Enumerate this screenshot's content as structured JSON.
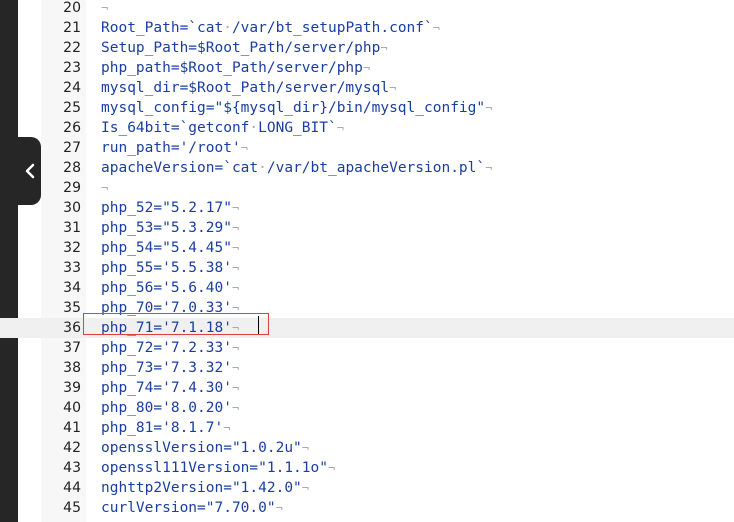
{
  "editor": {
    "collapse_icon": "chevron-left-icon",
    "eol_marker": "¬",
    "space_marker": "·",
    "lines": [
      {
        "num": "20",
        "segs": []
      },
      {
        "num": "21",
        "segs": [
          {
            "t": "Root_Path=`cat"
          },
          {
            "t": "·",
            "k": "sp"
          },
          {
            "t": "/var/bt_setupPath.conf`"
          }
        ]
      },
      {
        "num": "22",
        "segs": [
          {
            "t": "Setup_Path=$Root_Path/server/php"
          }
        ]
      },
      {
        "num": "23",
        "segs": [
          {
            "t": "php_path=$Root_Path/server/php"
          }
        ]
      },
      {
        "num": "24",
        "segs": [
          {
            "t": "mysql_dir=$Root_Path/server/mysql"
          }
        ]
      },
      {
        "num": "25",
        "segs": [
          {
            "t": "mysql_config=\"${mysql_dir}/bin/mysql_config\""
          }
        ]
      },
      {
        "num": "26",
        "segs": [
          {
            "t": "Is_64bit=`getconf"
          },
          {
            "t": "·",
            "k": "sp"
          },
          {
            "t": "LONG_BIT`"
          }
        ]
      },
      {
        "num": "27",
        "segs": [
          {
            "t": "run_path='/root'"
          }
        ]
      },
      {
        "num": "28",
        "segs": [
          {
            "t": "apacheVersion=`cat"
          },
          {
            "t": "·",
            "k": "sp"
          },
          {
            "t": "/var/bt_apacheVersion.pl`"
          }
        ]
      },
      {
        "num": "29",
        "segs": []
      },
      {
        "num": "30",
        "segs": [
          {
            "t": "php_52=\"5.2.17\""
          }
        ]
      },
      {
        "num": "31",
        "segs": [
          {
            "t": "php_53=\"5.3.29\""
          }
        ]
      },
      {
        "num": "32",
        "segs": [
          {
            "t": "php_54=\"5.4.45\""
          }
        ]
      },
      {
        "num": "33",
        "segs": [
          {
            "t": "php_55='5.5.38'"
          }
        ]
      },
      {
        "num": "34",
        "segs": [
          {
            "t": "php_56='5.6.40'"
          }
        ]
      },
      {
        "num": "35",
        "segs": [
          {
            "t": "php_70='7.0.33'"
          }
        ]
      },
      {
        "num": "36",
        "segs": [
          {
            "t": "php_71='7.1.18'"
          }
        ],
        "active": true
      },
      {
        "num": "37",
        "segs": [
          {
            "t": "php_72='7.2.33'"
          }
        ]
      },
      {
        "num": "38",
        "segs": [
          {
            "t": "php_73='7.3.32'"
          }
        ]
      },
      {
        "num": "39",
        "segs": [
          {
            "t": "php_74='7.4.30'"
          }
        ]
      },
      {
        "num": "40",
        "segs": [
          {
            "t": "php_80='8.0.20'"
          }
        ]
      },
      {
        "num": "41",
        "segs": [
          {
            "t": "php_81='8.1.7'"
          }
        ]
      },
      {
        "num": "42",
        "segs": [
          {
            "t": "opensslVersion=\"1.0.2u\""
          }
        ]
      },
      {
        "num": "43",
        "segs": [
          {
            "t": "openssl111Version=\"1.1.1o\""
          }
        ]
      },
      {
        "num": "44",
        "segs": [
          {
            "t": "nghttp2Version=\"1.42.0\""
          }
        ]
      },
      {
        "num": "45",
        "segs": [
          {
            "t": "curlVersion=\"7.70.0\""
          }
        ]
      }
    ]
  }
}
